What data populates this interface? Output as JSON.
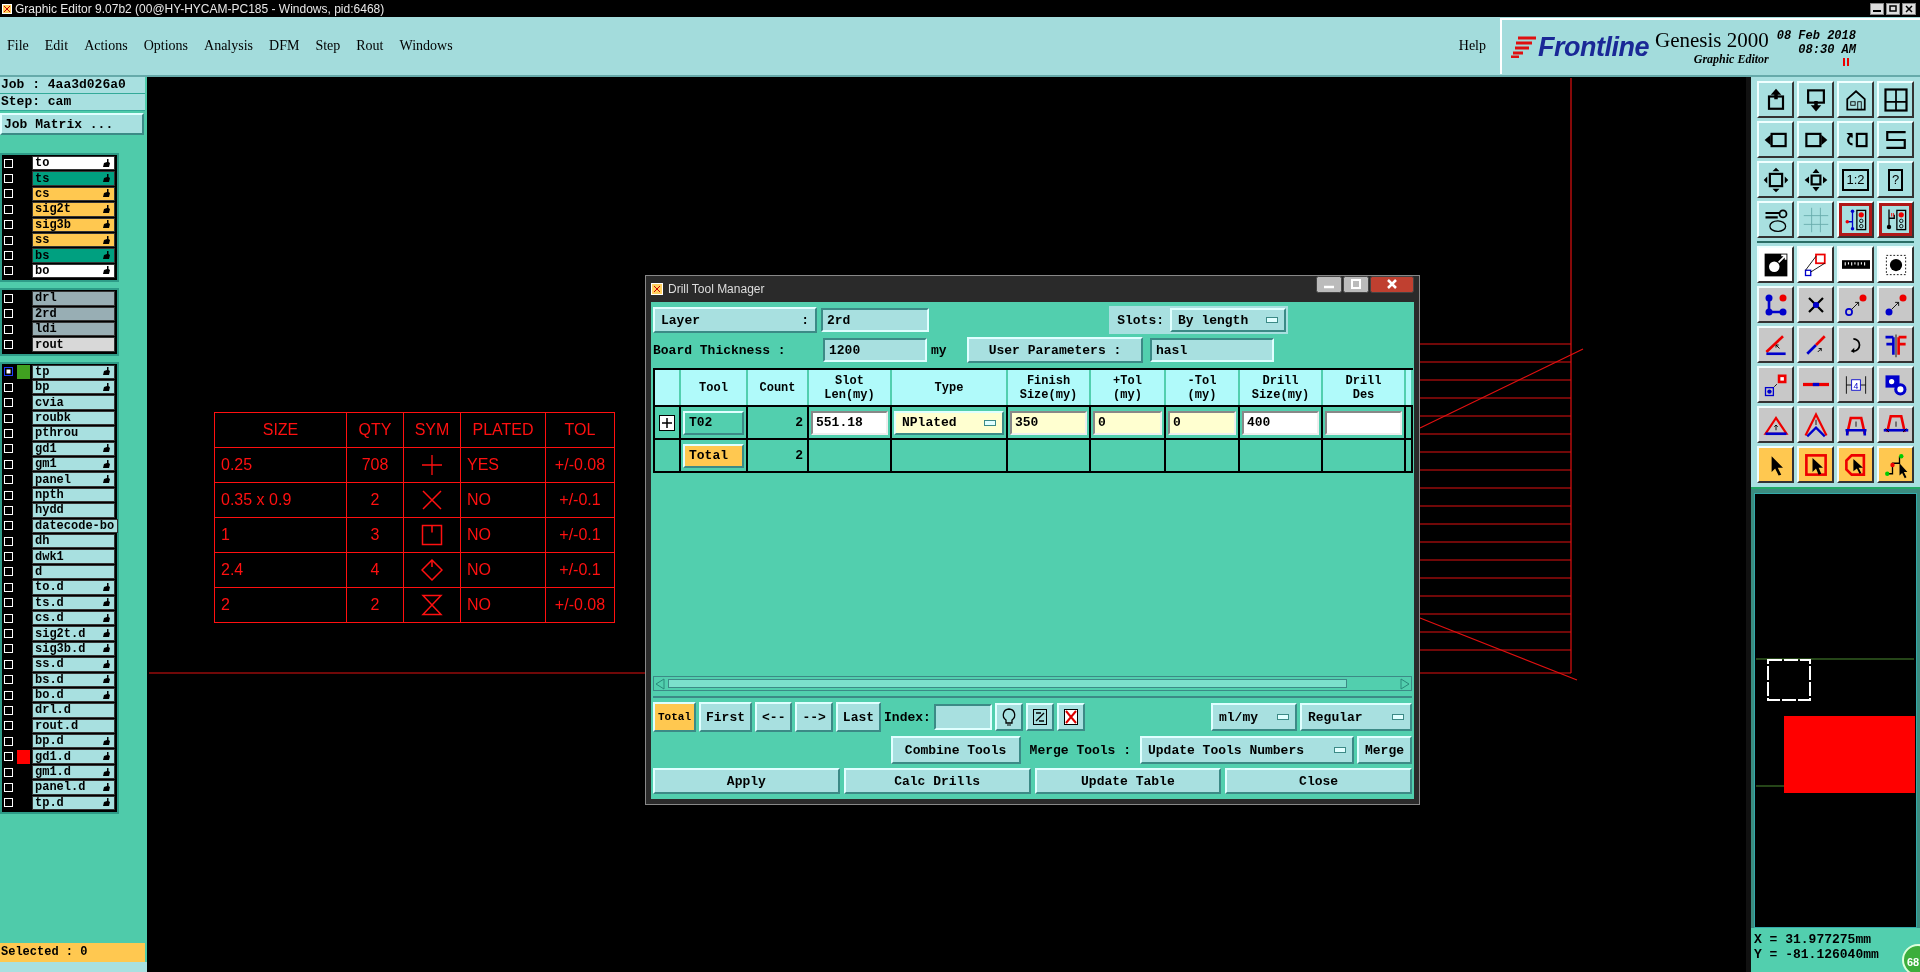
{
  "window": {
    "title": "Graphic Editor 9.07b2 (00@HY-HYCAM-PC185 - Windows, pid:6468)"
  },
  "menu": [
    "File",
    "Edit",
    "Actions",
    "Options",
    "Analysis",
    "DFM",
    "Step",
    "Rout",
    "Windows"
  ],
  "help": "Help",
  "brand": {
    "logo": "Frontline",
    "product": "Genesis 2000",
    "subtitle": "Graphic Editor",
    "date": "08 Feb 2018",
    "time": "08:30 AM"
  },
  "job": {
    "job": "Job : 4aa3d026a0",
    "step": "Step: cam",
    "matrix_button": "Job Matrix ..."
  },
  "layer_groups": [
    [
      {
        "name": "to",
        "color": "#ffffff",
        "flagged": true,
        "selected": false
      },
      {
        "name": "ts",
        "color": "#00a080",
        "flagged": true,
        "selected": false
      },
      {
        "name": "cs",
        "color": "#ffc850",
        "flagged": true,
        "selected": false
      },
      {
        "name": "sig2t",
        "color": "#ffc850",
        "flagged": true,
        "selected": false
      },
      {
        "name": "sig3b",
        "color": "#ffc850",
        "flagged": true,
        "selected": false
      },
      {
        "name": "ss",
        "color": "#ffc850",
        "flagged": true,
        "selected": false
      },
      {
        "name": "bs",
        "color": "#00a080",
        "flagged": true,
        "selected": false
      },
      {
        "name": "bo",
        "color": "#ffffff",
        "flagged": true,
        "selected": false
      }
    ],
    [
      {
        "name": "drl",
        "color": "#98aeb4",
        "flagged": false,
        "selected": false
      },
      {
        "name": "2rd",
        "color": "#98aeb4",
        "flagged": false,
        "selected": false
      },
      {
        "name": "ldi",
        "color": "#98aeb4",
        "flagged": false,
        "selected": false
      },
      {
        "name": "rout",
        "color": "#d8d8d8",
        "flagged": false,
        "selected": false
      }
    ],
    [
      {
        "name": "tp",
        "color": "#a8e0e0",
        "flagged": true,
        "selected": true,
        "swatch": {
          "color": "#40a020"
        }
      },
      {
        "name": "bp",
        "color": "#a8e0e0",
        "flagged": true,
        "selected": false
      },
      {
        "name": "cvia",
        "color": "#a8e0e0",
        "flagged": false,
        "selected": false
      },
      {
        "name": "roubk",
        "color": "#a8e0e0",
        "flagged": false,
        "selected": false
      },
      {
        "name": "pthrou",
        "color": "#a8e0e0",
        "flagged": false,
        "selected": false
      },
      {
        "name": "gd1",
        "color": "#a8e0e0",
        "flagged": true,
        "selected": false
      },
      {
        "name": "gm1",
        "color": "#a8e0e0",
        "flagged": true,
        "selected": false
      },
      {
        "name": "panel",
        "color": "#a8e0e0",
        "flagged": true,
        "selected": false
      },
      {
        "name": "npth",
        "color": "#a8e0e0",
        "flagged": false,
        "selected": false
      },
      {
        "name": "hydd",
        "color": "#a8e0e0",
        "flagged": false,
        "selected": false
      },
      {
        "name": "datecode-bo",
        "color": "#a8e0e0",
        "flagged": false,
        "selected": false
      },
      {
        "name": "dh",
        "color": "#a8e0e0",
        "flagged": false,
        "selected": false
      },
      {
        "name": "dwk1",
        "color": "#a8e0e0",
        "flagged": false,
        "selected": false
      },
      {
        "name": "d",
        "color": "#a8e0e0",
        "flagged": false,
        "selected": false
      },
      {
        "name": "to.d",
        "color": "#a8e0e0",
        "flagged": true,
        "selected": false
      },
      {
        "name": "ts.d",
        "color": "#a8e0e0",
        "flagged": true,
        "selected": false
      },
      {
        "name": "cs.d",
        "color": "#a8e0e0",
        "flagged": true,
        "selected": false
      },
      {
        "name": "sig2t.d",
        "color": "#a8e0e0",
        "flagged": true,
        "selected": false
      },
      {
        "name": "sig3b.d",
        "color": "#a8e0e0",
        "flagged": true,
        "selected": false
      },
      {
        "name": "ss.d",
        "color": "#a8e0e0",
        "flagged": true,
        "selected": false
      },
      {
        "name": "bs.d",
        "color": "#a8e0e0",
        "flagged": true,
        "selected": false
      },
      {
        "name": "bo.d",
        "color": "#a8e0e0",
        "flagged": true,
        "selected": false
      },
      {
        "name": "drl.d",
        "color": "#a8e0e0",
        "flagged": false,
        "selected": false
      },
      {
        "name": "rout.d",
        "color": "#a8e0e0",
        "flagged": false,
        "selected": false
      },
      {
        "name": "bp.d",
        "color": "#a8e0e0",
        "flagged": true,
        "selected": false
      },
      {
        "name": "gd1.d",
        "color": "#a8e0e0",
        "flagged": true,
        "selected": false,
        "swatch": {
          "color": "#ff0000"
        }
      },
      {
        "name": "gm1.d",
        "color": "#a8e0e0",
        "flagged": true,
        "selected": false
      },
      {
        "name": "panel.d",
        "color": "#a8e0e0",
        "flagged": true,
        "selected": false
      },
      {
        "name": "tp.d",
        "color": "#a8e0e0",
        "flagged": true,
        "selected": false
      }
    ]
  ],
  "selected_count": "Selected : 0",
  "drill_legend": {
    "columns": [
      "SIZE",
      "QTY",
      "SYM",
      "PLATED",
      "TOL"
    ],
    "rows": [
      {
        "size": "0.25",
        "qty": "708",
        "kind": "plus",
        "plated": "YES",
        "tol": "+/-0.08"
      },
      {
        "size": "0.35 x 0.9",
        "qty": "2",
        "kind": "cross",
        "plated": "NO",
        "tol": "+/-0.1"
      },
      {
        "size": "1",
        "qty": "3",
        "kind": "square",
        "plated": "NO",
        "tol": "+/-0.1"
      },
      {
        "size": "2.4",
        "qty": "4",
        "kind": "diamond",
        "plated": "NO",
        "tol": "+/-0.1"
      },
      {
        "size": "2",
        "qty": "2",
        "kind": "hourglass",
        "plated": "NO",
        "tol": "+/-0.08"
      }
    ]
  },
  "dialog": {
    "title": "Drill Tool Manager",
    "layer_label": "Layer",
    "layer_colon": ":",
    "layer": "2rd",
    "slots_label": "Slots:",
    "slots": "By length",
    "thickness_label": "Board Thickness :",
    "thickness": "1200",
    "thickness_unit": "my",
    "user_params": "User Parameters :",
    "user_params_value": "hasl",
    "columns": [
      "Tool",
      "Count",
      "Slot\nLen(my)",
      "Type",
      "Finish\nSize(my)",
      "+Tol\n(my)",
      "-Tol\n(my)",
      "Drill\nSize(my)",
      "Drill\nDes"
    ],
    "tools": [
      {
        "expanded": false,
        "tool": "T02",
        "count": "2",
        "slot_len": "551.18",
        "type": "NPlated",
        "finish": "350",
        "plus_tol": "0",
        "minus_tol": "0",
        "drill_size": "400"
      }
    ],
    "total": {
      "label": "Total",
      "count": "2"
    },
    "nav": [
      {
        "label": "Total",
        "selected": true
      },
      {
        "label": "First",
        "selected": false
      },
      {
        "label": "<--",
        "selected": false
      },
      {
        "label": "-->",
        "selected": false
      },
      {
        "label": "Last",
        "selected": false
      }
    ],
    "index_label": "Index:",
    "units": "ml/my",
    "mode": "Regular",
    "combine": "Combine Tools",
    "merge_label": "Merge Tools :",
    "merge_mode": "Update Tools Numbers",
    "merge": "Merge",
    "buttons": [
      "Apply",
      "Calc Drills",
      "Update Table",
      "Close"
    ]
  },
  "toolbar": {
    "ratio_label": "1:2",
    "help_label": "?",
    "measure_label": "4"
  },
  "coordinates": {
    "x": "X = 31.977275mm",
    "y": "Y = -81.126040mm"
  },
  "badge": "68"
}
